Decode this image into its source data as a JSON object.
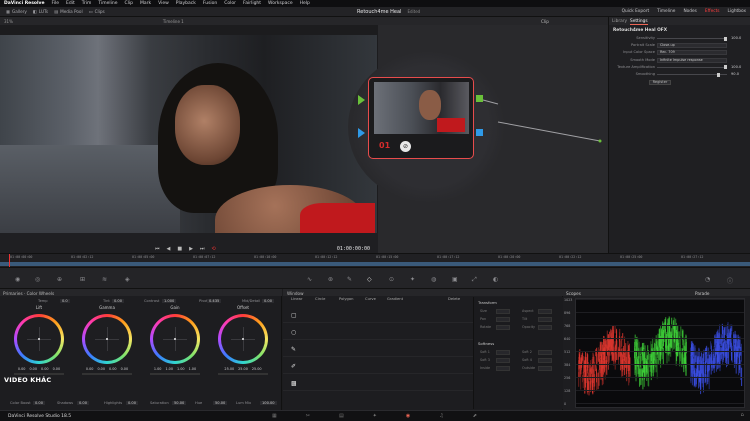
{
  "menu": [
    "DaVinci Resolve",
    "File",
    "Edit",
    "Trim",
    "Timeline",
    "Clip",
    "Mark",
    "View",
    "Playback",
    "Fusion",
    "Color",
    "Fairlight",
    "Workspace",
    "Help"
  ],
  "toolbar": {
    "left_items": [
      "Gallery",
      "LUTs",
      "Media Pool",
      "Clips"
    ],
    "project_title": "Retouch4me Heal",
    "project_status": "Edited",
    "timeline_name": "Timeline 1",
    "clip_label": "Clip",
    "right_items": [
      "Quick Export",
      "Timeline",
      "Nodes",
      "Effects",
      "Lightbox"
    ]
  },
  "viewer": {
    "zoom": "31%",
    "timecode": "01:00:00:00"
  },
  "ruler_timecodes": [
    "01:00:00:00",
    "01:00:02:12",
    "01:00:05:00",
    "01:00:07:12",
    "01:00:10:00",
    "01:00:12:12",
    "01:00:15:00",
    "01:00:17:12",
    "01:00:20:00",
    "01:00:22:12",
    "01:00:25:00",
    "01:00:27:12"
  ],
  "node": {
    "number": "01"
  },
  "inspector": {
    "tabs": [
      "Library",
      "Settings"
    ],
    "plugin_title": "Retouch4me Heal OFX",
    "params": [
      {
        "label": "Sensitivity",
        "value": "100.0",
        "type": "slider",
        "pct": 1.0
      },
      {
        "label": "Portrait Scale",
        "value": "Close-up",
        "type": "select"
      },
      {
        "label": "Input Color Space",
        "value": "Rec. 709",
        "type": "select"
      },
      {
        "label": "Smooth Mode",
        "value": "Infinite Impulse response",
        "type": "select"
      },
      {
        "label": "Texture Amplification",
        "value": "100.0",
        "type": "slider",
        "pct": 1.0
      },
      {
        "label": "Smoothing",
        "value": "90.0",
        "type": "slider",
        "pct": 0.9
      }
    ],
    "register_label": "Register"
  },
  "primaries": {
    "header": "Primaries · Color Wheels",
    "top_controls": [
      {
        "label": "Temp",
        "value": "0.0"
      },
      {
        "label": "Tint",
        "value": "0.00"
      },
      {
        "label": "Contrast",
        "value": "1.000"
      },
      {
        "label": "Pivot",
        "value": "0.435"
      },
      {
        "label": "Mid/Detail",
        "value": "0.00"
      }
    ],
    "wheels": [
      {
        "name": "Lift",
        "values": [
          "0.00",
          "0.00",
          "0.00",
          "0.00"
        ]
      },
      {
        "name": "Gamma",
        "values": [
          "0.00",
          "0.00",
          "0.00",
          "0.00"
        ]
      },
      {
        "name": "Gain",
        "values": [
          "1.00",
          "1.00",
          "1.00",
          "1.00"
        ]
      },
      {
        "name": "Offset",
        "values": [
          "25.00",
          "25.00",
          "25.00"
        ]
      }
    ],
    "footer": [
      {
        "label": "Color Boost",
        "value": "0.00"
      },
      {
        "label": "Shadows",
        "value": "0.00"
      },
      {
        "label": "Highlights",
        "value": "0.00"
      },
      {
        "label": "Saturation",
        "value": "50.00"
      },
      {
        "label": "Hue",
        "value": "50.00"
      },
      {
        "label": "Lum Mix",
        "value": "100.00"
      }
    ],
    "watermark": "VIDEO KHÁC"
  },
  "window_panel": {
    "header": "Window",
    "shapes": [
      "Linear",
      "Circle",
      "Polygon",
      "Curve",
      "Gradient"
    ],
    "right_label": "Delete",
    "transform_title": "Transform",
    "transform_fields": [
      "Size",
      "Aspect",
      "Pan",
      "Tilt",
      "Rotate",
      "Opacity"
    ],
    "softness_title": "Softness",
    "softness_fields": [
      "Soft 1",
      "Soft 2",
      "Soft 3",
      "Soft 4",
      "Inside",
      "Outside"
    ]
  },
  "scopes": {
    "header": "Scopes",
    "mode": "Parade",
    "scale": [
      "1023",
      "896",
      "768",
      "640",
      "512",
      "384",
      "256",
      "128",
      "0"
    ]
  },
  "status": {
    "app_label": "DaVinci Resolve Studio 18.5"
  }
}
